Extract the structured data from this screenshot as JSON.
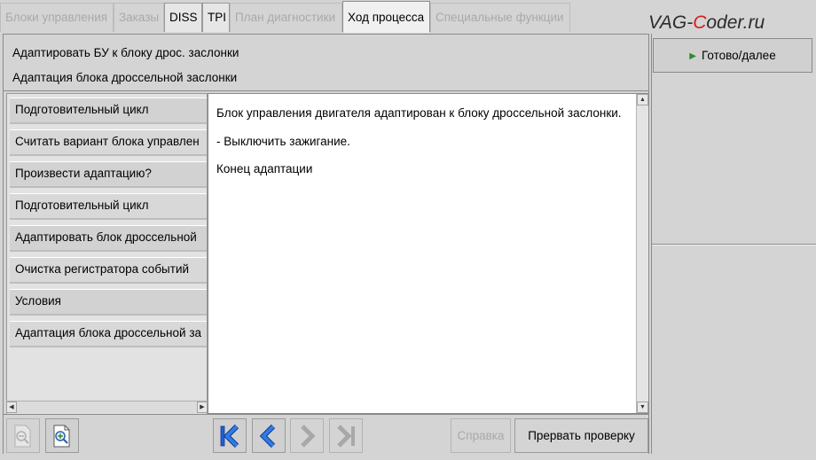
{
  "tabs": [
    {
      "label": "Блоки управления",
      "state": "disabled"
    },
    {
      "label": "Заказы",
      "state": "disabled"
    },
    {
      "label": "DISS",
      "state": "enabled"
    },
    {
      "label": "TPI",
      "state": "enabled"
    },
    {
      "label": "План диагностики",
      "state": "disabled"
    },
    {
      "label": "Ход процесса",
      "state": "selected"
    },
    {
      "label": "Специальные функции",
      "state": "disabled"
    }
  ],
  "watermark": {
    "prefix": "VAG-",
    "highlight": "C",
    "suffix": "oder.ru"
  },
  "header": {
    "line1": "Адаптировать БУ к блоку дрос. заслонки",
    "line2": "Адаптация блока дроссельной заслонки"
  },
  "steps": [
    "Подготовительный цикл",
    "Считать вариант блока управлен",
    "Произвести адаптацию?",
    "Подготовительный цикл",
    "Адаптировать блок дроссельной",
    "Очистка регистратора событий",
    "Условия",
    "Адаптация блока дроссельной за"
  ],
  "message_lines": [
    "Блок управления двигателя адаптирован к блоку дроссельной заслонки.",
    "- Выключить зажигание.",
    "Конец адаптации"
  ],
  "buttons": {
    "help": "Справка",
    "abort": "Прервать проверку",
    "ready": "Готово/далее"
  },
  "icons": {
    "zoom_out": "zoom-out-icon",
    "zoom_in": "zoom-in-icon",
    "first": "first-page-icon",
    "prev": "previous-page-icon",
    "next": "next-page-icon",
    "last": "last-page-icon",
    "play": "play-icon"
  },
  "colors": {
    "nav_active": "#1f5fd6",
    "nav_disabled": "#a8a8a8",
    "play_green": "#2e8b2e",
    "watermark_red": "#d81d1d"
  }
}
